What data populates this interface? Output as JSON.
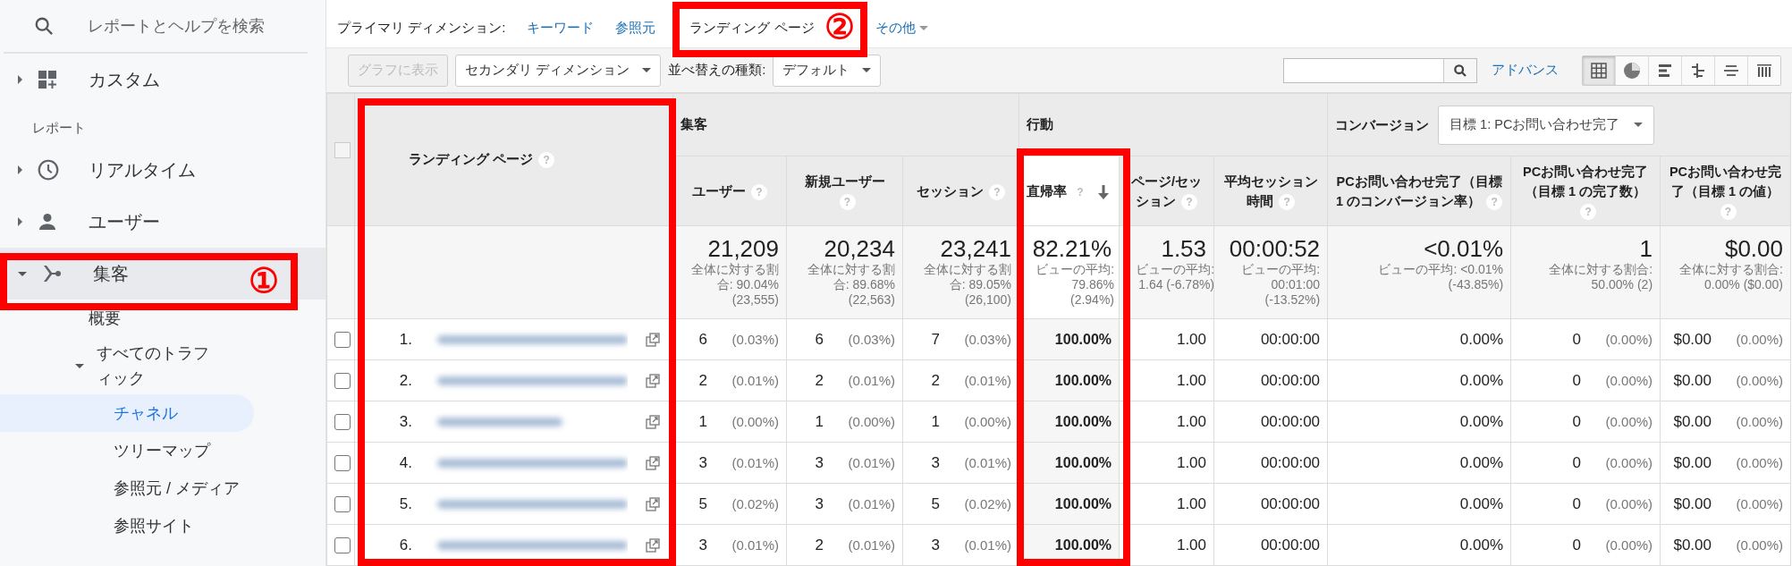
{
  "annotations": [
    {
      "label": "①"
    },
    {
      "label": "②"
    }
  ],
  "sidebar": {
    "search": {
      "placeholder": "レポートとヘルプを検索"
    },
    "items": [
      {
        "kind": "nav",
        "label": "カスタム",
        "expanded": false,
        "selected": false
      },
      {
        "kind": "heading",
        "label": "レポート"
      },
      {
        "kind": "nav",
        "label": "リアルタイム",
        "expanded": false,
        "selected": false
      },
      {
        "kind": "nav",
        "label": "ユーザー",
        "expanded": false,
        "selected": false
      },
      {
        "kind": "nav",
        "label": "集客",
        "expanded": true,
        "selected": true,
        "children": [
          {
            "label": "概要",
            "selected": false
          },
          {
            "label": "すべてのトラフィック",
            "expanded": true,
            "selected": false,
            "children": [
              {
                "label": "チャネル",
                "selected": true
              },
              {
                "label": "ツリーマップ",
                "selected": false
              },
              {
                "label": "参照元 / メディア",
                "selected": false
              },
              {
                "label": "参照サイト",
                "selected": false
              }
            ]
          }
        ]
      }
    ]
  },
  "primary_dimension": {
    "label": "プライマリ ディメンション:",
    "options": [
      {
        "label": "キーワード",
        "selected": false
      },
      {
        "label": "参照元",
        "selected": false
      },
      {
        "label": "ランディング ページ",
        "selected": true
      }
    ],
    "more": {
      "label": "その他"
    }
  },
  "toolbar": {
    "graph_button": {
      "label": "グラフに表示",
      "disabled": true
    },
    "secondary_dimension": {
      "label": "セカンダリ ディメンション"
    },
    "sort_label": "並べ替えの種類:",
    "sort_select": {
      "value": "デフォルト"
    },
    "advanced_link": "アドバンス",
    "views": [
      {
        "selected": true
      },
      {
        "selected": false
      },
      {
        "selected": false
      },
      {
        "selected": false
      },
      {
        "selected": false
      },
      {
        "selected": false
      }
    ]
  },
  "table": {
    "select_all": {
      "checked": false
    },
    "dimension_header": {
      "label": "ランディング ページ",
      "help": "?"
    },
    "groups": [
      {
        "label": "集客",
        "columns": [
          {
            "label": "ユーザー",
            "help": "?",
            "sorted": false,
            "total": "21,209",
            "note": "全体に対する割合: 90.04% (23,555)"
          },
          {
            "label": "新規ユーザー",
            "help": "?",
            "sorted": false,
            "total": "20,234",
            "note": "全体に対する割合: 89.68% (22,563)"
          },
          {
            "label": "セッション",
            "help": "?",
            "sorted": false,
            "total": "23,241",
            "note": "全体に対する割合: 89.05% (26,100)"
          }
        ]
      },
      {
        "label": "行動",
        "columns": [
          {
            "label": "直帰率",
            "help": "?",
            "sorted": true,
            "total": "82.21%",
            "note": "ビューの平均: 79.86% (2.94%)"
          },
          {
            "label": "ページ/セッション",
            "help": "?",
            "sorted": false,
            "total": "1.53",
            "note": "ビューの平均: 1.64 (-6.78%)"
          },
          {
            "label": "平均セッション時間",
            "help": "?",
            "sorted": false,
            "total": "00:00:52",
            "note": "ビューの平均: 00:01:00 (-13.52%)"
          }
        ]
      },
      {
        "label": "コンバージョン",
        "goal_select": "目標 1: PCお問い合わせ完了",
        "columns": [
          {
            "label": "PCお問い合わせ完了（目標 1 のコンバージョン率）",
            "help": "?",
            "sorted": false,
            "total": "<0.01%",
            "note": "ビューの平均: <0.01% (-43.85%)"
          },
          {
            "label": "PCお問い合わせ完了（目標 1 の完了数）",
            "help": "?",
            "sorted": false,
            "total": "1",
            "note": "全体に対する割合: 50.00% (2)"
          },
          {
            "label": "PCお問い合わせ完了（目標 1 の値）",
            "help": "?",
            "sorted": false,
            "total": "$0.00",
            "note": "全体に対する割合: 0.00% ($0.00)"
          }
        ]
      }
    ],
    "rows": [
      {
        "number": "1.",
        "checked": false,
        "cells": [
          {
            "value": "6",
            "share": "(0.03%)"
          },
          {
            "value": "6",
            "share": "(0.03%)"
          },
          {
            "value": "7",
            "share": "(0.03%)"
          },
          {
            "value": "100.00%"
          },
          {
            "value": "1.00"
          },
          {
            "value": "00:00:00"
          },
          {
            "value": "0.00%"
          },
          {
            "value": "0",
            "share": "(0.00%)"
          },
          {
            "value": "$0.00",
            "share": "(0.00%)"
          }
        ]
      },
      {
        "number": "2.",
        "checked": false,
        "cells": [
          {
            "value": "2",
            "share": "(0.01%)"
          },
          {
            "value": "2",
            "share": "(0.01%)"
          },
          {
            "value": "2",
            "share": "(0.01%)"
          },
          {
            "value": "100.00%"
          },
          {
            "value": "1.00"
          },
          {
            "value": "00:00:00"
          },
          {
            "value": "0.00%"
          },
          {
            "value": "0",
            "share": "(0.00%)"
          },
          {
            "value": "$0.00",
            "share": "(0.00%)"
          }
        ]
      },
      {
        "number": "3.",
        "checked": false,
        "cells": [
          {
            "value": "1",
            "share": "(0.00%)"
          },
          {
            "value": "1",
            "share": "(0.00%)"
          },
          {
            "value": "1",
            "share": "(0.00%)"
          },
          {
            "value": "100.00%"
          },
          {
            "value": "1.00"
          },
          {
            "value": "00:00:00"
          },
          {
            "value": "0.00%"
          },
          {
            "value": "0",
            "share": "(0.00%)"
          },
          {
            "value": "$0.00",
            "share": "(0.00%)"
          }
        ]
      },
      {
        "number": "4.",
        "checked": false,
        "cells": [
          {
            "value": "3",
            "share": "(0.01%)"
          },
          {
            "value": "3",
            "share": "(0.01%)"
          },
          {
            "value": "3",
            "share": "(0.01%)"
          },
          {
            "value": "100.00%"
          },
          {
            "value": "1.00"
          },
          {
            "value": "00:00:00"
          },
          {
            "value": "0.00%"
          },
          {
            "value": "0",
            "share": "(0.00%)"
          },
          {
            "value": "$0.00",
            "share": "(0.00%)"
          }
        ]
      },
      {
        "number": "5.",
        "checked": false,
        "cells": [
          {
            "value": "5",
            "share": "(0.02%)"
          },
          {
            "value": "3",
            "share": "(0.01%)"
          },
          {
            "value": "5",
            "share": "(0.02%)"
          },
          {
            "value": "100.00%"
          },
          {
            "value": "1.00"
          },
          {
            "value": "00:00:00"
          },
          {
            "value": "0.00%"
          },
          {
            "value": "0",
            "share": "(0.00%)"
          },
          {
            "value": "$0.00",
            "share": "(0.00%)"
          }
        ]
      },
      {
        "number": "6.",
        "checked": false,
        "cells": [
          {
            "value": "3",
            "share": "(0.01%)"
          },
          {
            "value": "2",
            "share": "(0.01%)"
          },
          {
            "value": "3",
            "share": "(0.01%)"
          },
          {
            "value": "100.00%"
          },
          {
            "value": "1.00"
          },
          {
            "value": "00:00:00"
          },
          {
            "value": "0.00%"
          },
          {
            "value": "0",
            "share": "(0.00%)"
          },
          {
            "value": "$0.00",
            "share": "(0.00%)"
          }
        ]
      }
    ]
  }
}
